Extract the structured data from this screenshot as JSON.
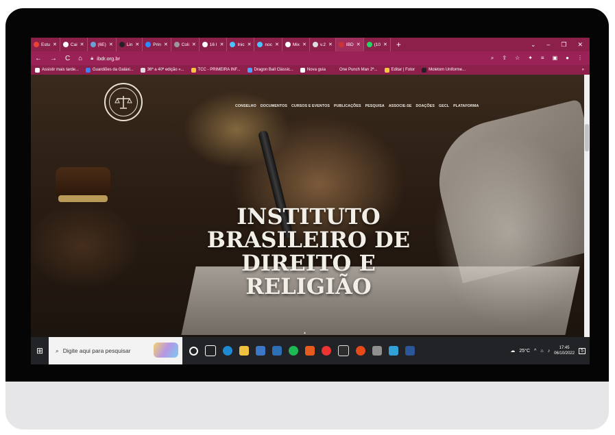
{
  "browser": {
    "tabs": [
      {
        "label": "Estu",
        "icon": "google-icon",
        "color": "#ea4335"
      },
      {
        "label": "Cai",
        "icon": "gmail-icon",
        "color": "#ffffff"
      },
      {
        "label": "(6E)",
        "icon": "profile-icon",
        "color": "#6aa2d8"
      },
      {
        "label": "Lin",
        "icon": "link-icon",
        "color": "#222222"
      },
      {
        "label": "Prin",
        "icon": "print-icon",
        "color": "#2d8cff"
      },
      {
        "label": "Coli",
        "icon": "col-icon",
        "color": "#999999"
      },
      {
        "label": "16 I",
        "icon": "chrome-icon",
        "color": "#ffffff"
      },
      {
        "label": "Inic",
        "icon": "home-icon",
        "color": "#4cc2ff"
      },
      {
        "label": "noc",
        "icon": "edge-icon",
        "color": "#4cc2ff"
      },
      {
        "label": "Mix",
        "icon": "chrome-icon",
        "color": "#ffffff"
      },
      {
        "label": "v.2",
        "icon": "doc-icon",
        "color": "#dddddd"
      },
      {
        "label": "IBD",
        "icon": "ibdr-icon",
        "color": "#c33"
      },
      {
        "label": "(10",
        "icon": "whatsapp-icon",
        "color": "#25d366"
      }
    ],
    "url": "ibdr.org.br",
    "bookmarks": [
      {
        "label": "Assistir mais tarde...",
        "color": "#ffffff"
      },
      {
        "label": "Guardiões da Galáxi...",
        "color": "#3b82f6"
      },
      {
        "label": "36ª a 40ª edição «...",
        "color": "#dddddd"
      },
      {
        "label": "TCC - PRIMEIRA INF...",
        "color": "#f5c542"
      },
      {
        "label": "Dragon Ball Clássic...",
        "color": "#4aa3ff"
      },
      {
        "label": "Nova guia",
        "color": "#ffffff"
      },
      {
        "label": "One Punch Man 2ª...",
        "color": "#8d1f4b"
      },
      {
        "label": "Editar | Fotor",
        "color": "#f5c542"
      },
      {
        "label": "Moletom Uniforme...",
        "color": "#222222"
      }
    ]
  },
  "site": {
    "menu": [
      "CONSELHO",
      "DOCUMENTOS",
      "CURSOS E EVENTOS",
      "PUBLICAÇÕES",
      "PESQUISA",
      "ASSOCIE-SE",
      "DOAÇÕES",
      "GECL",
      "PLATAFORMA"
    ],
    "hero_lines": [
      "INSTITUTO",
      "BRASILEIRO DE",
      "DIREITO E",
      "RELIGIÃO"
    ]
  },
  "taskbar": {
    "search_placeholder": "Digite aqui para pesquisar",
    "temperature": "25°C",
    "time": "17:45",
    "date": "06/10/2022",
    "notification_count": "5"
  },
  "colors": {
    "browser_accent": "#8d1f4b",
    "address_bar": "#9b2256"
  }
}
